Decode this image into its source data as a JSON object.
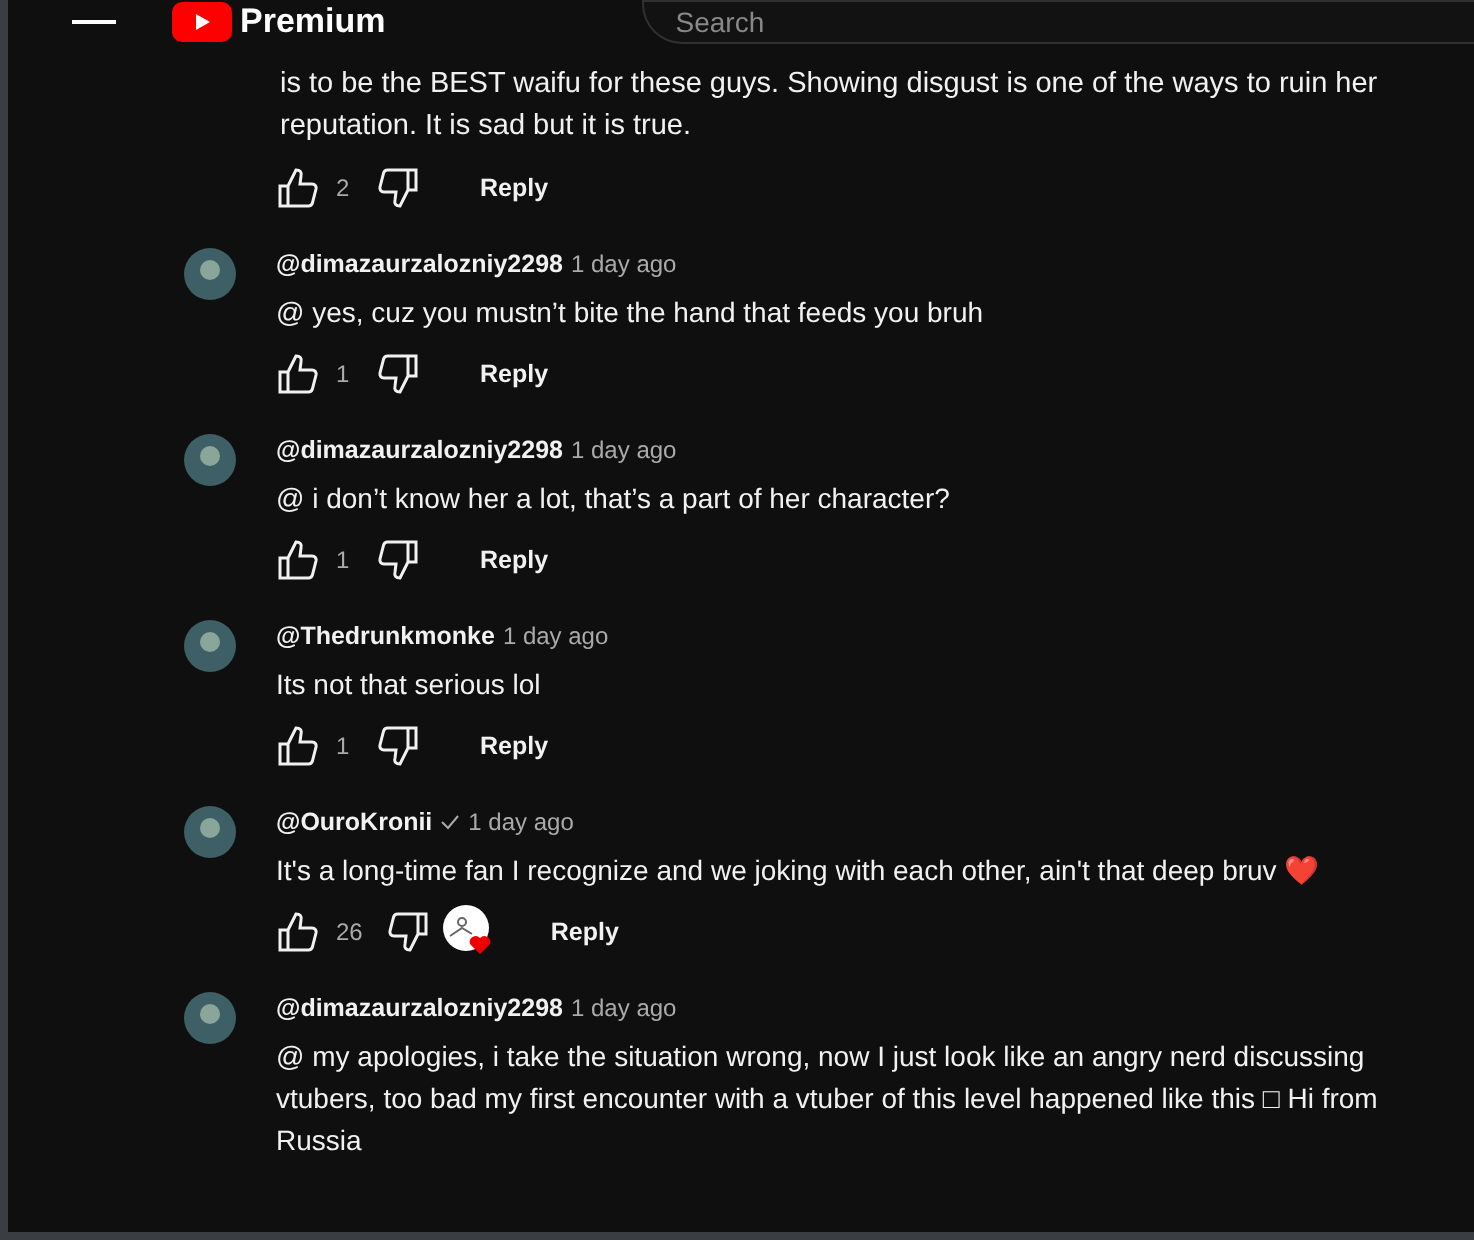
{
  "header": {
    "logo_text": "Premium",
    "search": {
      "placeholder": "Search"
    }
  },
  "parent_comment": {
    "text": "is to be the BEST waifu for these guys. Showing disgust is one of the ways to ruin her reputation. It is sad but it is true.",
    "likes": "2",
    "reply": "Reply"
  },
  "replies": [
    {
      "author": "@dimazaurzalozniy2298",
      "verified": false,
      "time": "1 day ago",
      "text": "@ yes, cuz you mustn’t bite the hand that feeds you bruh",
      "likes": "1",
      "hearted": false,
      "reply": "Reply"
    },
    {
      "author": "@dimazaurzalozniy2298",
      "verified": false,
      "time": "1 day ago",
      "text": "@ i don’t know her a lot, that’s a part of her character?",
      "likes": "1",
      "hearted": false,
      "reply": "Reply"
    },
    {
      "author": "@Thedrunkmonke",
      "verified": false,
      "time": "1 day ago",
      "text": "Its not that serious lol",
      "likes": "1",
      "hearted": false,
      "reply": "Reply"
    },
    {
      "author": "@OuroKronii",
      "verified": true,
      "time": "1 day ago",
      "text": "It's a long-time fan I recognize and we joking with each other, ain't that deep bruv ❤️",
      "likes": "26",
      "hearted": true,
      "reply": "Reply"
    },
    {
      "author": "@dimazaurzalozniy2298",
      "verified": false,
      "time": "1 day ago",
      "text": "@ my apologies, i take the situation wrong, now I just look like an angry nerd discussing vtubers, too bad my first encounter with a vtuber of this level happened like this □ Hi from Russia",
      "hearted": false
    }
  ]
}
